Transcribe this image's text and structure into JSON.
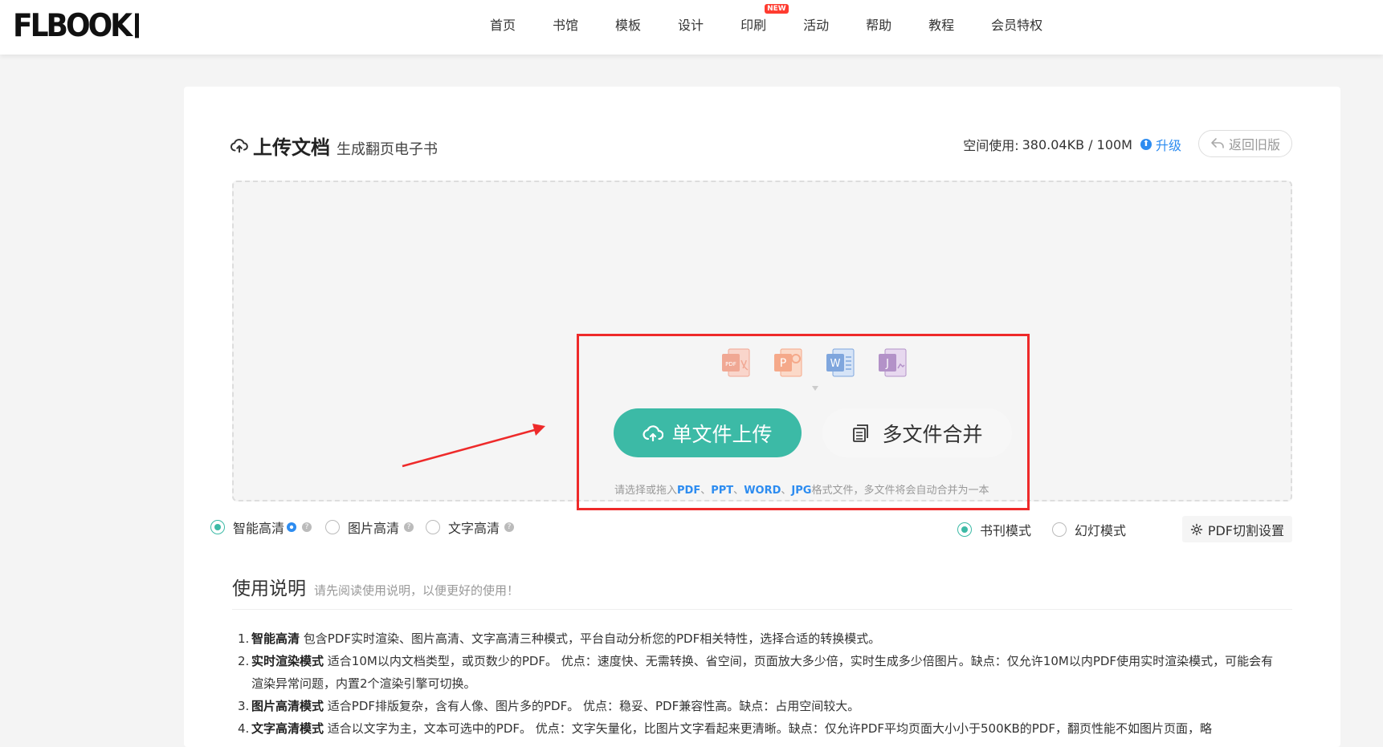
{
  "header": {
    "logo": "FLBOOK",
    "nav": [
      {
        "label": "首页"
      },
      {
        "label": "书馆"
      },
      {
        "label": "模板"
      },
      {
        "label": "设计"
      },
      {
        "label": "印刷",
        "badge": "NEW"
      },
      {
        "label": "活动"
      },
      {
        "label": "帮助"
      },
      {
        "label": "教程"
      },
      {
        "label": "会员特权"
      }
    ]
  },
  "upload": {
    "title": "上传文档",
    "subtitle": "生成翻页电子书",
    "space_label": "空间使用:",
    "space_value": "380.04KB / 100M",
    "upgrade_label": "升级",
    "back_old_label": "返回旧版",
    "file_types": [
      "PDF",
      "PPT",
      "WORD",
      "JPG"
    ],
    "single_upload_label": "单文件上传",
    "multi_merge_label": "多文件合并",
    "hint_prefix": "请选择或拖入",
    "hint_sep1": "、",
    "hint_sep2": "、",
    "hint_sep3": "、",
    "hint_suffix": "格式文件，多文件将会自动合并为一本"
  },
  "options": {
    "quality": [
      {
        "label": "智能高清",
        "checked": true
      },
      {
        "label": "图片高清",
        "checked": false
      },
      {
        "label": "文字高清",
        "checked": false
      }
    ],
    "mode": [
      {
        "label": "书刊模式",
        "checked": true
      },
      {
        "label": "幻灯模式",
        "checked": false
      }
    ],
    "pdf_cut_label": "PDF切割设置"
  },
  "usage": {
    "title": "使用说明",
    "subtitle": "请先阅读使用说明，以便更好的使用！",
    "items": [
      {
        "num": "1.",
        "head": "智能高清",
        "text": " 包含PDF实时渲染、图片高清、文字高清三种模式，平台自动分析您的PDF相关特性，选择合适的转换模式。"
      },
      {
        "num": "2.",
        "head": "实时渲染模式",
        "text": " 适合10M以内文档类型，或页数少的PDF。 优点：速度快、无需转换、省空间，页面放大多少倍，实时生成多少倍图片。缺点：仅允许10M以内PDF使用实时渲染模式，可能会有渲染异常问题，内置2个渲染引擎可切换。"
      },
      {
        "num": "3.",
        "head": "图片高清模式",
        "text": " 适合PDF排版复杂，含有人像、图片多的PDF。 优点：稳妥、PDF兼容性高。缺点：占用空间较大。"
      },
      {
        "num": "4.",
        "head": "文字高清模式",
        "text": " 适合以文字为主，文本可选中的PDF。 优点：文字矢量化，比图片文字看起来更清晰。缺点：仅允许PDF平均页面大小小于500KB的PDF，翻页性能不如图片页面，略"
      }
    ]
  },
  "colors": {
    "accent": "#3cbaa6",
    "link": "#2d8cf0",
    "highlight_border": "#ee2a2a"
  }
}
